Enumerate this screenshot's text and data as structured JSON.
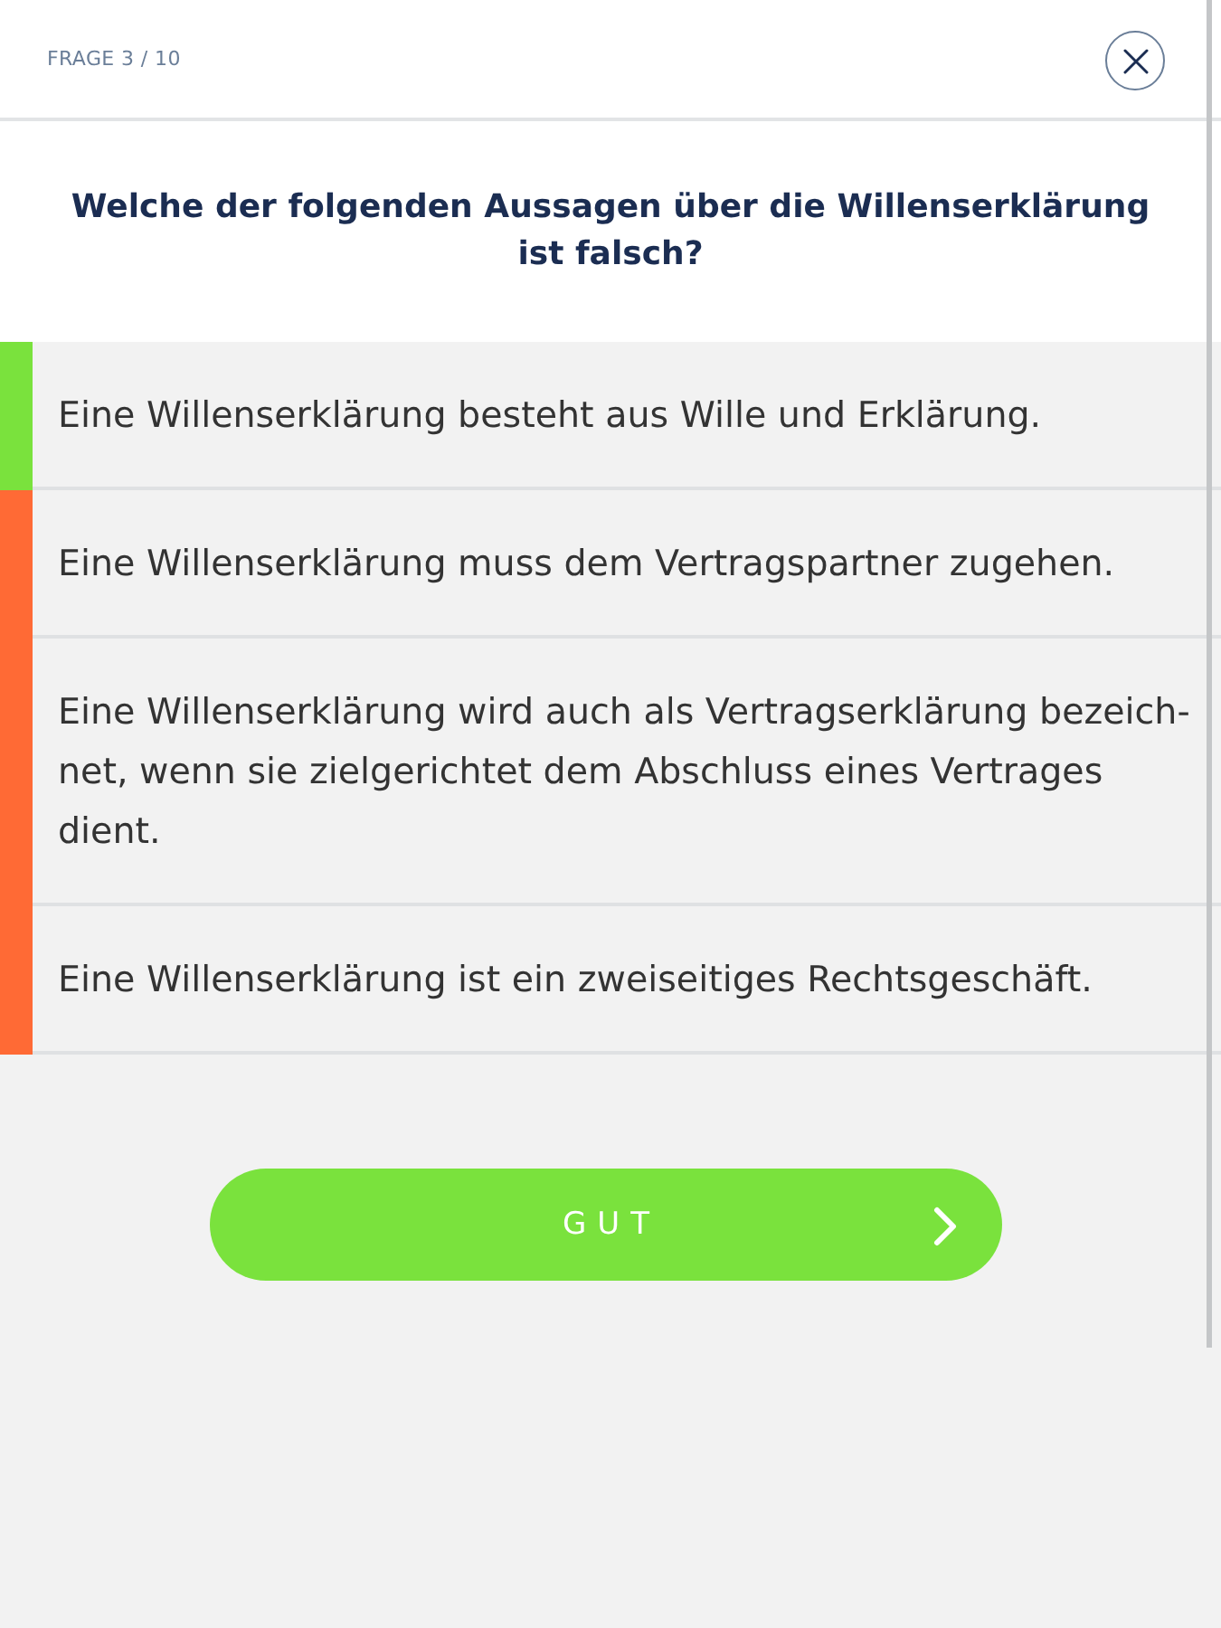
{
  "header": {
    "progress": "FRAGE 3 / 10"
  },
  "question": "Welche der folgenden Aussagen über die Willenserklärung ist falsch?",
  "answers": [
    {
      "text": "Eine Willenserklärung besteht aus Wille und Erklärung.",
      "color": "#7ae23d"
    },
    {
      "text": "Eine Willenserklärung muss dem Vertragspartner zugehen.",
      "color": "#ff6a35"
    },
    {
      "text": "Eine Willenserklärung wird auch als Vertragserklärung bezeich-net, wenn sie zielgerichtet dem Abschluss eines Vertrages dient.",
      "color": "#ff6a35"
    },
    {
      "text": "Eine Willenserklärung ist ein zweiseitiges Rechtsgeschäft.",
      "color": "#ff6a35"
    }
  ],
  "continue_button": {
    "label": "GUT"
  }
}
